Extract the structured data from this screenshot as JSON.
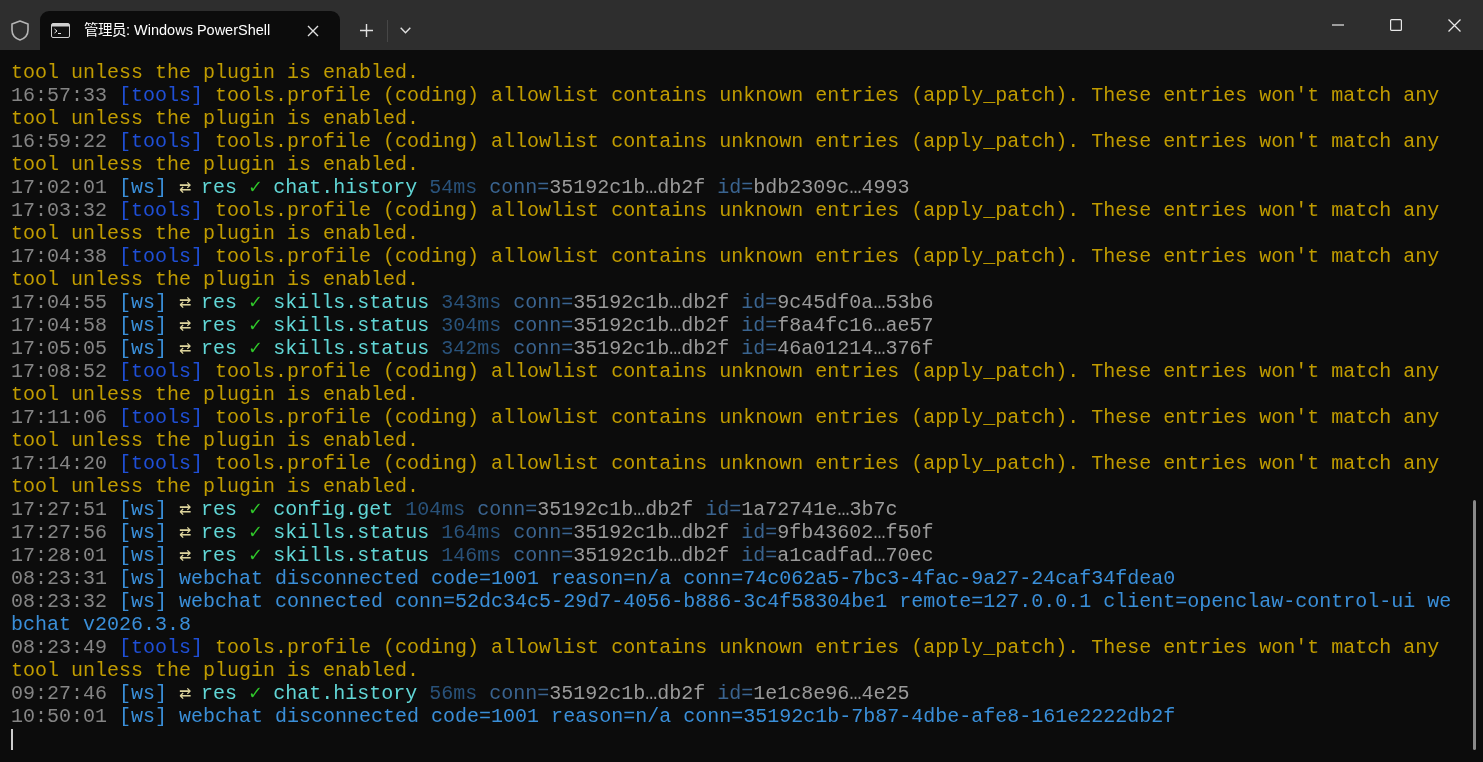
{
  "window": {
    "tabs": [
      {
        "title": "管理员: Windows PowerShell",
        "selected": true
      }
    ]
  },
  "terminal": {
    "lines": [
      {
        "tokens": [
          {
            "kind": "warning",
            "text": "tool unless the plugin is enabled."
          }
        ]
      },
      {
        "tokens": [
          {
            "kind": "time",
            "text": "16:57:33"
          },
          {
            "kind": "tools_tag",
            "text": "[tools]"
          },
          {
            "kind": "warning",
            "text": "tools.profile (coding) allowlist contains unknown entries (apply_patch). These entries won't match any tool unless the plugin is enabled."
          }
        ]
      },
      {
        "tokens": [
          {
            "kind": "time",
            "text": "16:59:22"
          },
          {
            "kind": "tools_tag",
            "text": "[tools]"
          },
          {
            "kind": "warning",
            "text": "tools.profile (coding) allowlist contains unknown entries (apply_patch). These entries won't match any tool unless the plugin is enabled."
          }
        ]
      },
      {
        "tokens": [
          {
            "kind": "time",
            "text": "17:02:01"
          },
          {
            "kind": "ws_tag",
            "text": "[ws]"
          },
          {
            "kind": "direction",
            "arrow": "⇄",
            "text": "res"
          },
          {
            "kind": "ok",
            "text": "✓"
          },
          {
            "kind": "method",
            "text": "chat.history"
          },
          {
            "kind": "duration",
            "text": "54ms"
          },
          {
            "kind": "field",
            "key": "conn=",
            "value": "35192c1b…db2f"
          },
          {
            "kind": "field",
            "key": "id=",
            "value": "bdb2309c…4993"
          }
        ]
      },
      {
        "tokens": [
          {
            "kind": "time",
            "text": "17:03:32"
          },
          {
            "kind": "tools_tag",
            "text": "[tools]"
          },
          {
            "kind": "warning",
            "text": "tools.profile (coding) allowlist contains unknown entries (apply_patch). These entries won't match any tool unless the plugin is enabled."
          }
        ]
      },
      {
        "tokens": [
          {
            "kind": "time",
            "text": "17:04:38"
          },
          {
            "kind": "tools_tag",
            "text": "[tools]"
          },
          {
            "kind": "warning",
            "text": "tools.profile (coding) allowlist contains unknown entries (apply_patch). These entries won't match any tool unless the plugin is enabled."
          }
        ]
      },
      {
        "tokens": [
          {
            "kind": "time",
            "text": "17:04:55"
          },
          {
            "kind": "ws_tag",
            "text": "[ws]"
          },
          {
            "kind": "direction",
            "arrow": "⇄",
            "text": "res"
          },
          {
            "kind": "ok",
            "text": "✓"
          },
          {
            "kind": "method",
            "text": "skills.status"
          },
          {
            "kind": "duration",
            "text": "343ms"
          },
          {
            "kind": "field",
            "key": "conn=",
            "value": "35192c1b…db2f"
          },
          {
            "kind": "field",
            "key": "id=",
            "value": "9c45df0a…53b6"
          }
        ]
      },
      {
        "tokens": [
          {
            "kind": "time",
            "text": "17:04:58"
          },
          {
            "kind": "ws_tag",
            "text": "[ws]"
          },
          {
            "kind": "direction",
            "arrow": "⇄",
            "text": "res"
          },
          {
            "kind": "ok",
            "text": "✓"
          },
          {
            "kind": "method",
            "text": "skills.status"
          },
          {
            "kind": "duration",
            "text": "304ms"
          },
          {
            "kind": "field",
            "key": "conn=",
            "value": "35192c1b…db2f"
          },
          {
            "kind": "field",
            "key": "id=",
            "value": "f8a4fc16…ae57"
          }
        ]
      },
      {
        "tokens": [
          {
            "kind": "time",
            "text": "17:05:05"
          },
          {
            "kind": "ws_tag",
            "text": "[ws]"
          },
          {
            "kind": "direction",
            "arrow": "⇄",
            "text": "res"
          },
          {
            "kind": "ok",
            "text": "✓"
          },
          {
            "kind": "method",
            "text": "skills.status"
          },
          {
            "kind": "duration",
            "text": "342ms"
          },
          {
            "kind": "field",
            "key": "conn=",
            "value": "35192c1b…db2f"
          },
          {
            "kind": "field",
            "key": "id=",
            "value": "46a01214…376f"
          }
        ]
      },
      {
        "tokens": [
          {
            "kind": "time",
            "text": "17:08:52"
          },
          {
            "kind": "tools_tag",
            "text": "[tools]"
          },
          {
            "kind": "warning",
            "text": "tools.profile (coding) allowlist contains unknown entries (apply_patch). These entries won't match any tool unless the plugin is enabled."
          }
        ]
      },
      {
        "tokens": [
          {
            "kind": "time",
            "text": "17:11:06"
          },
          {
            "kind": "tools_tag",
            "text": "[tools]"
          },
          {
            "kind": "warning",
            "text": "tools.profile (coding) allowlist contains unknown entries (apply_patch). These entries won't match any tool unless the plugin is enabled."
          }
        ]
      },
      {
        "tokens": [
          {
            "kind": "time",
            "text": "17:14:20"
          },
          {
            "kind": "tools_tag",
            "text": "[tools]"
          },
          {
            "kind": "warning",
            "text": "tools.profile (coding) allowlist contains unknown entries (apply_patch). These entries won't match any tool unless the plugin is enabled."
          }
        ]
      },
      {
        "tokens": [
          {
            "kind": "time",
            "text": "17:27:51"
          },
          {
            "kind": "ws_tag",
            "text": "[ws]"
          },
          {
            "kind": "direction",
            "arrow": "⇄",
            "text": "res"
          },
          {
            "kind": "ok",
            "text": "✓"
          },
          {
            "kind": "method",
            "text": "config.get"
          },
          {
            "kind": "duration",
            "text": "104ms"
          },
          {
            "kind": "field",
            "key": "conn=",
            "value": "35192c1b…db2f"
          },
          {
            "kind": "field",
            "key": "id=",
            "value": "1a72741e…3b7c"
          }
        ]
      },
      {
        "tokens": [
          {
            "kind": "time",
            "text": "17:27:56"
          },
          {
            "kind": "ws_tag",
            "text": "[ws]"
          },
          {
            "kind": "direction",
            "arrow": "⇄",
            "text": "res"
          },
          {
            "kind": "ok",
            "text": "✓"
          },
          {
            "kind": "method",
            "text": "skills.status"
          },
          {
            "kind": "duration",
            "text": "164ms"
          },
          {
            "kind": "field",
            "key": "conn=",
            "value": "35192c1b…db2f"
          },
          {
            "kind": "field",
            "key": "id=",
            "value": "9fb43602…f50f"
          }
        ]
      },
      {
        "tokens": [
          {
            "kind": "time",
            "text": "17:28:01"
          },
          {
            "kind": "ws_tag",
            "text": "[ws]"
          },
          {
            "kind": "direction",
            "arrow": "⇄",
            "text": "res"
          },
          {
            "kind": "ok",
            "text": "✓"
          },
          {
            "kind": "method",
            "text": "skills.status"
          },
          {
            "kind": "duration",
            "text": "146ms"
          },
          {
            "kind": "field",
            "key": "conn=",
            "value": "35192c1b…db2f"
          },
          {
            "kind": "field",
            "key": "id=",
            "value": "a1cadfad…70ec"
          }
        ]
      },
      {
        "tokens": [
          {
            "kind": "time",
            "text": "08:23:31"
          },
          {
            "kind": "ws_tag",
            "text": "[ws]"
          },
          {
            "kind": "event",
            "text": "webchat disconnected code=1001 reason=n/a conn=74c062a5-7bc3-4fac-9a27-24caf34fdea0"
          }
        ]
      },
      {
        "tokens": [
          {
            "kind": "time",
            "text": "08:23:32"
          },
          {
            "kind": "ws_tag",
            "text": "[ws]"
          },
          {
            "kind": "event",
            "text": "webchat connected conn=52dc34c5-29d7-4056-b886-3c4f58304be1 remote=127.0.0.1 client=openclaw-control-ui webchat v2026.3.8"
          }
        ]
      },
      {
        "tokens": [
          {
            "kind": "time",
            "text": "08:23:49"
          },
          {
            "kind": "tools_tag",
            "text": "[tools]"
          },
          {
            "kind": "warning",
            "text": "tools.profile (coding) allowlist contains unknown entries (apply_patch). These entries won't match any tool unless the plugin is enabled."
          }
        ]
      },
      {
        "tokens": [
          {
            "kind": "time",
            "text": "09:27:46"
          },
          {
            "kind": "ws_tag",
            "text": "[ws]"
          },
          {
            "kind": "direction",
            "arrow": "⇄",
            "text": "res"
          },
          {
            "kind": "ok",
            "text": "✓"
          },
          {
            "kind": "method",
            "text": "chat.history"
          },
          {
            "kind": "duration",
            "text": "56ms"
          },
          {
            "kind": "field",
            "key": "conn=",
            "value": "35192c1b…db2f"
          },
          {
            "kind": "field",
            "key": "id=",
            "value": "1e1c8e96…4e25"
          }
        ]
      },
      {
        "tokens": [
          {
            "kind": "time",
            "text": "10:50:01"
          },
          {
            "kind": "ws_tag",
            "text": "[ws]"
          },
          {
            "kind": "event",
            "text": "webchat disconnected code=1001 reason=n/a conn=35192c1b-7b87-4dbe-afe8-161e2222db2f"
          }
        ]
      }
    ]
  }
}
